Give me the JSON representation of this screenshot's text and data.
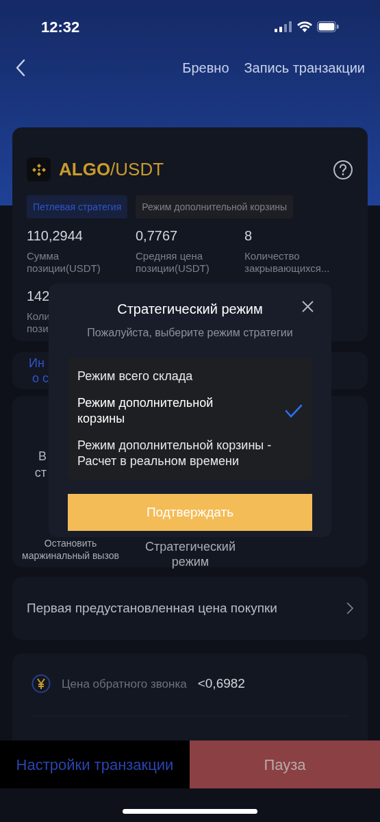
{
  "status_bar": {
    "time": "12:32"
  },
  "nav": {
    "links": [
      "Бревно",
      "Запись транзакции"
    ]
  },
  "pair": {
    "base": "ALGO",
    "quote": "/USDT"
  },
  "tags": [
    {
      "label": "Петлевая стратегия",
      "kind": "primary"
    },
    {
      "label": "Режим дополнительной корзины",
      "kind": "secondary"
    }
  ],
  "stats": [
    {
      "value": "110,2944",
      "label": "Сумма позиции(USDT)"
    },
    {
      "value": "0,7767",
      "label": "Средняя цена позиции(USDT)"
    },
    {
      "value": "8",
      "label": "Количество закрывающихся..."
    }
  ],
  "partial_stat": {
    "value": "142",
    "label_lines": [
      "Коли",
      "пози"
    ]
  },
  "info_link": {
    "lines": [
      "Ин",
      "о с"
    ]
  },
  "action_card": {
    "partial_lines": [
      "В",
      "ст"
    ],
    "actions": [
      "Остановить маржинальный вызов",
      "Стратегический режим"
    ]
  },
  "preset_row": {
    "label": "Первая предустановленная цена покупки"
  },
  "price_row": {
    "label": "Цена обратного звонка",
    "value": "<0,6982"
  },
  "bottom_bar": {
    "settings": "Настройки транзакции",
    "pause": "Пауза"
  },
  "modal": {
    "title": "Стратегический режим",
    "subtitle": "Пожалуйста, выберите режим стратегии",
    "options": [
      {
        "label": "Режим всего склада",
        "selected": false
      },
      {
        "label": "Режим дополнительной корзины",
        "selected": true
      },
      {
        "label": "Режим дополнительной корзины - Расчет в реальном времени",
        "selected": false
      }
    ],
    "confirm": "Подтверждать"
  }
}
